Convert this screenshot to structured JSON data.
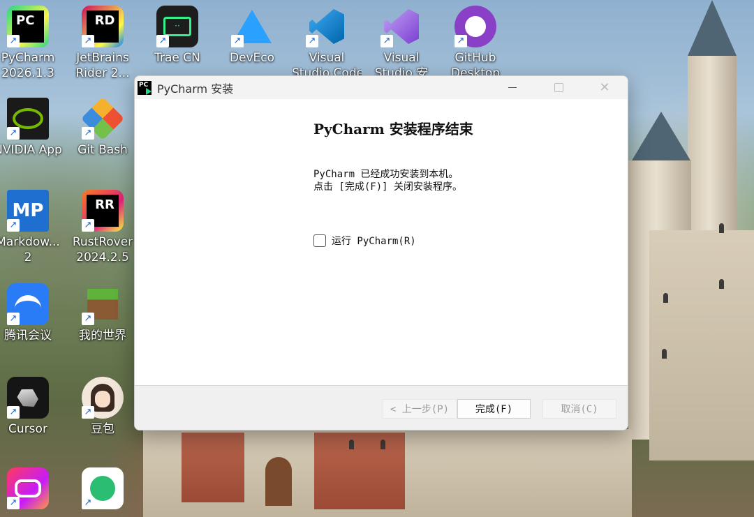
{
  "desktop": {
    "icons": [
      {
        "label": "PyCharm\n2026.1.3",
        "icon": "pycharm-icon"
      },
      {
        "label": "JetBrains\nRider 2...",
        "icon": "rider-icon"
      },
      {
        "label": "Trae CN",
        "icon": "trae-icon"
      },
      {
        "label": "DevEco\nStudio",
        "icon": "deveco-icon"
      },
      {
        "label": "Visual\nStudio Code",
        "icon": "vscode-icon"
      },
      {
        "label": "Visual\nStudio 安",
        "icon": "visual-studio-icon"
      },
      {
        "label": "GitHub\nDesktop",
        "icon": "github-icon"
      },
      {
        "label": "NVIDIA App",
        "icon": "nvidia-icon"
      },
      {
        "label": "Git Bash",
        "icon": "git-bash-icon"
      },
      {
        "label": "Markdow...\n2",
        "icon": "markdown-icon"
      },
      {
        "label": "RustRover\n2024.2.5",
        "icon": "rustrover-icon"
      },
      {
        "label": "腾讯会议",
        "icon": "tencent-meeting-icon"
      },
      {
        "label": "我的世界",
        "icon": "minecraft-icon"
      },
      {
        "label": "Cursor",
        "icon": "cursor-icon"
      },
      {
        "label": "豆包",
        "icon": "doubao-icon"
      },
      {
        "label": "",
        "icon": "adobe-cc-icon"
      },
      {
        "label": "",
        "icon": "tencent-app-icon"
      }
    ],
    "tiles": {
      "PC": "PC",
      "RD": "RD",
      "MP": "MP",
      "RR": "RR"
    }
  },
  "installer": {
    "window_title": "PyCharm 安装",
    "heading": "PyCharm 安装程序结束",
    "line1": "PyCharm 已经成功安装到本机。",
    "line2": "点击 [完成(F)] 关闭安装程序。",
    "checkbox_label": "运行 PyCharm(R)",
    "checkbox_checked": false,
    "back_button": "< 上一步(P)",
    "finish_button": "完成(F)",
    "cancel_button": "取消(C)"
  },
  "colors": {
    "pycharm_green": "#21d789",
    "accent_blue": "#1b62c4"
  }
}
